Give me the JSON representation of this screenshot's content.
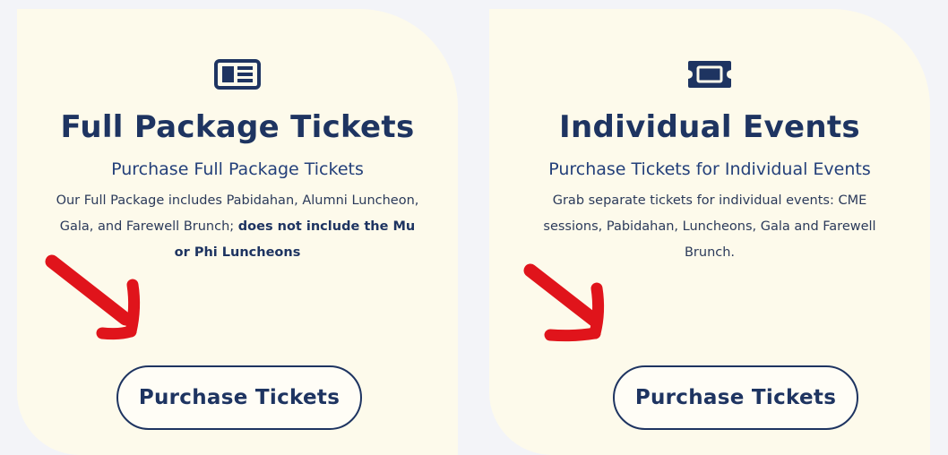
{
  "cards": {
    "full_package": {
      "icon": "newspaper-icon",
      "title": "Full Package Tickets",
      "subtitle": "Purchase Full Package Tickets",
      "description_prefix": "Our Full Package includes Pabidahan, Alumni Luncheon, Gala, and Farewell Brunch; ",
      "description_bold": "does not include the Mu or Phi Luncheons",
      "button_label": "Purchase Tickets"
    },
    "individual_events": {
      "icon": "ticket-icon",
      "title": "Individual Events",
      "subtitle": "Purchase Tickets for Individual Events",
      "description": "Grab separate tickets for individual events: CME sessions, Pabidahan, Luncheons, Gala and Farewell Brunch.",
      "button_label": "Purchase Tickets"
    }
  },
  "colors": {
    "navy": "#1e3461",
    "card_background": "#fdfaeb",
    "page_background": "#f3f4f8",
    "annotation_arrow": "#e0141b"
  },
  "annotations": {
    "arrow_icon": "arrow-down-right-icon"
  }
}
